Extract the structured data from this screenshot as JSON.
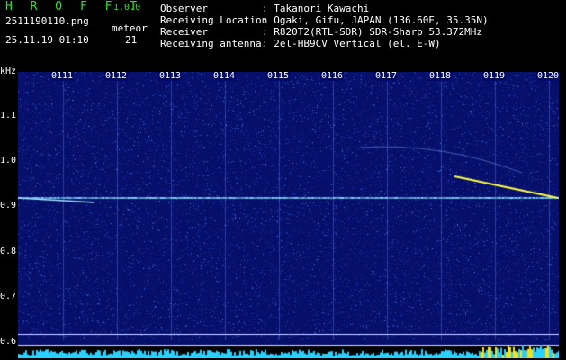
{
  "header": {
    "app_title": "H R O F F T",
    "app_version": "1.0.0",
    "file_name": "2511190110.png",
    "date_time": "25.11.19 01:10",
    "meteor_label": "meteor",
    "meteor_count": "21"
  },
  "info": [
    {
      "label": "Observer",
      "value": ": Takanori Kawachi"
    },
    {
      "label": "Receiving Location",
      "value": ": Ogaki, Gifu, JAPAN (136.60E, 35.35N)"
    },
    {
      "label": "Receiver",
      "value": ": R820T2(RTL-SDR) SDR-Sharp 53.372MHz"
    },
    {
      "label": "Receiving antenna",
      "value": ": 2el-HB9CV Vertical (el. E-W)"
    }
  ],
  "spectrogram": {
    "unit_label": "kHz",
    "y_ticks": [
      "1.1",
      "1.0",
      "0.9",
      "0.8",
      "0.7",
      "0.6"
    ],
    "time_labels": [
      "0111",
      "0112",
      "0113",
      "0114",
      "0115",
      "0116",
      "0117",
      "0118",
      "0119",
      "0120"
    ],
    "colors": {
      "background": "#06106a",
      "carrier": "#7fd6ff",
      "meteor": "#ffff40",
      "histogram": "#2ad0ff",
      "histogram_peak": "#f0e020"
    }
  }
}
